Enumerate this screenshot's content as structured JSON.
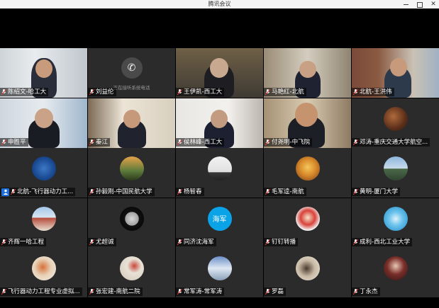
{
  "window": {
    "title": "腾讯会议"
  },
  "colors": {
    "accent": "#1e6fd9",
    "muted_mic": "#e33b3b"
  },
  "participants": [
    {
      "name": "陈绍文-哈工大",
      "kind": "video"
    },
    {
      "name": "刘益伦",
      "kind": "phone",
      "note": "正在接听系统电话"
    },
    {
      "name": "王伊凯-西工大",
      "kind": "video"
    },
    {
      "name": "马艳红-北航",
      "kind": "video"
    },
    {
      "name": "北航-王洪伟",
      "kind": "video"
    },
    {
      "name": "申胜平",
      "kind": "video"
    },
    {
      "name": "秦江",
      "kind": "video"
    },
    {
      "name": "侯林峰-西工大",
      "kind": "video"
    },
    {
      "name": "付尧明-中飞院",
      "kind": "video"
    },
    {
      "name": "邓涛-重庆交通大学航空...",
      "kind": "avatar"
    },
    {
      "name": "北航-飞行器动力工...",
      "kind": "avatar",
      "host_badge": true
    },
    {
      "name": "孙毅刚-中国民航大学",
      "kind": "avatar"
    },
    {
      "name": "杨智春",
      "kind": "avatar"
    },
    {
      "name": "毛军逵-南航",
      "kind": "avatar"
    },
    {
      "name": "黄明-厦门大学",
      "kind": "avatar"
    },
    {
      "name": "齐辉一哈工程",
      "kind": "avatar"
    },
    {
      "name": "尤超诚",
      "kind": "avatar"
    },
    {
      "name": "同济沈海军",
      "kind": "avatar",
      "avatar_text": "海军"
    },
    {
      "name": "钉钉转播",
      "kind": "avatar"
    },
    {
      "name": "成利-西北工业大学",
      "kind": "avatar"
    },
    {
      "name": "飞行器动力工程专业虚拟...",
      "kind": "avatar"
    },
    {
      "name": "张宏建-南航二院",
      "kind": "avatar"
    },
    {
      "name": "常军涛-常军涛",
      "kind": "avatar"
    },
    {
      "name": "罗磊",
      "kind": "avatar"
    },
    {
      "name": "丁永杰",
      "kind": "avatar"
    }
  ]
}
